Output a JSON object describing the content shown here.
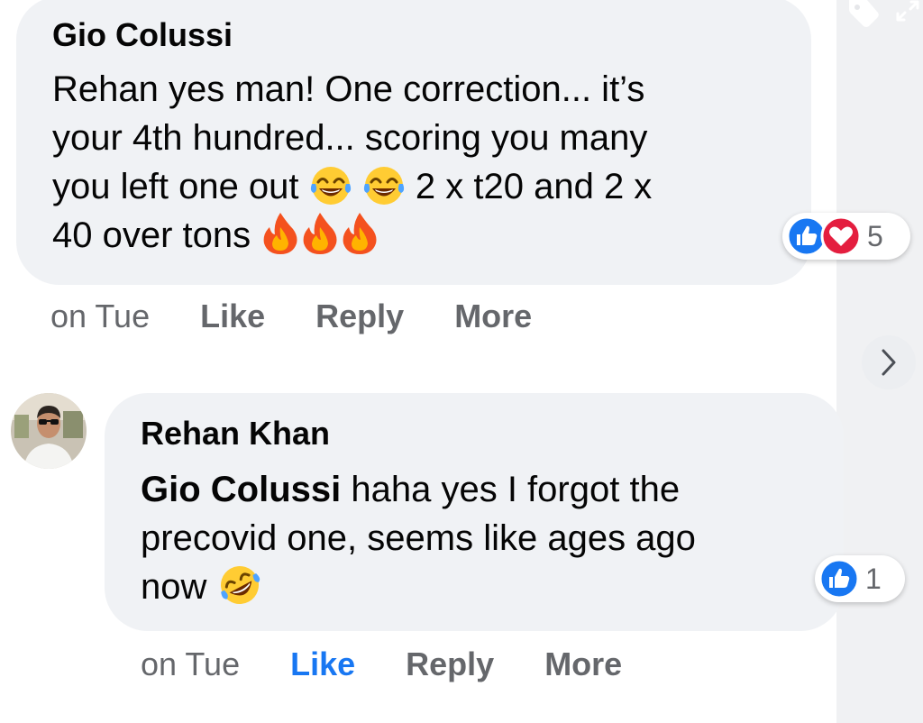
{
  "comments": [
    {
      "author": "Gio Colussi",
      "lines": [
        {
          "parts": [
            "Rehan yes man! One correction... it’s"
          ]
        },
        {
          "parts": [
            "your 4th hundred... scoring you many"
          ]
        },
        {
          "parts": [
            "you left one out ",
            "2 x t20 and 2 x"
          ]
        },
        {
          "parts": [
            "40 over tons "
          ]
        }
      ],
      "emojis": [
        "tears-of-joy",
        "tears-of-joy",
        "fire",
        "fire",
        "fire"
      ],
      "reactions": {
        "types": [
          "like",
          "love"
        ],
        "count": "5"
      },
      "actions": {
        "time": "on Tue",
        "like": "Like",
        "reply": "Reply",
        "more": "More",
        "like_active": false
      }
    },
    {
      "author": "Rehan Khan",
      "mention": "Gio Colussi",
      "lines": [
        {
          "parts": [
            "haha yes I forgot the"
          ]
        },
        {
          "parts": [
            "precovid one, seems like ages ago"
          ]
        },
        {
          "parts": [
            "now "
          ]
        }
      ],
      "emojis": [
        "rolling-on-floor-laughing"
      ],
      "reactions": {
        "types": [
          "like"
        ],
        "count": "1"
      },
      "actions": {
        "time": "on Tue",
        "like": "Like",
        "reply": "Reply",
        "more": "More",
        "like_active": true
      }
    }
  ],
  "colors": {
    "bubble": "#f0f2f5",
    "like_blue": "#1877f2",
    "love_red": "#e41e3f",
    "meta_gray": "#65676b",
    "text": "#050505"
  },
  "icons": {
    "top_right": [
      "tag-icon",
      "expand-icon"
    ],
    "side": "chevron-right-icon"
  }
}
